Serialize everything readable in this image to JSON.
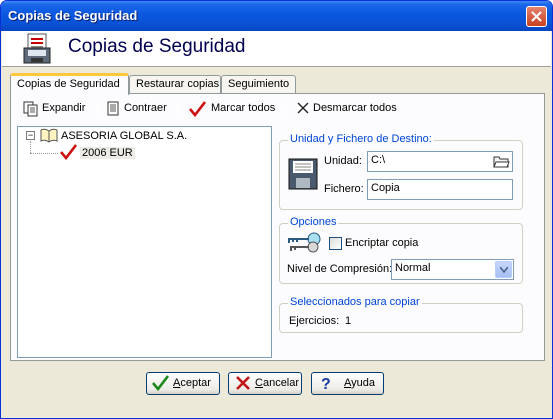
{
  "window": {
    "title": "Copias de Seguridad"
  },
  "header": {
    "title": "Copias de Seguridad"
  },
  "tabs": [
    {
      "label": "Copias de Seguridad"
    },
    {
      "label": "Restaurar copias"
    },
    {
      "label": "Seguimiento"
    }
  ],
  "toolbar": {
    "expand_label": "Expandir",
    "collapse_label": "Contraer",
    "mark_all_label": "Marcar todos",
    "unmark_all_label": "Desmarcar todos"
  },
  "tree": {
    "company": "ASESORIA GLOBAL S.A.",
    "exercise": "2006 EUR",
    "expander": "−"
  },
  "destination": {
    "group_title": "Unidad y Fichero de Destino:",
    "unit_label": "Unidad:",
    "unit_value": "C:\\",
    "file_label": "Fichero:",
    "file_value": "Copia"
  },
  "options": {
    "group_title": "Opciones",
    "encrypt_label": "Encriptar copia",
    "encrypt_checked": false,
    "compression_label": "Nivel de Compresión:",
    "compression_value": "Normal"
  },
  "selected": {
    "group_title": "Seleccionados para copiar",
    "exercises_label": "Ejercicios:",
    "exercises_value": "1"
  },
  "buttons": {
    "accept_first": "A",
    "accept_rest": "ceptar",
    "cancel_first": "C",
    "cancel_rest": "ancelar",
    "help_first": "A",
    "help_rest": "yuda"
  },
  "colors": {
    "titlebar": "#0a58e0",
    "group_title": "#0046d5",
    "active_tab_accent": "#ffc83c",
    "check_red": "#cc1010"
  }
}
